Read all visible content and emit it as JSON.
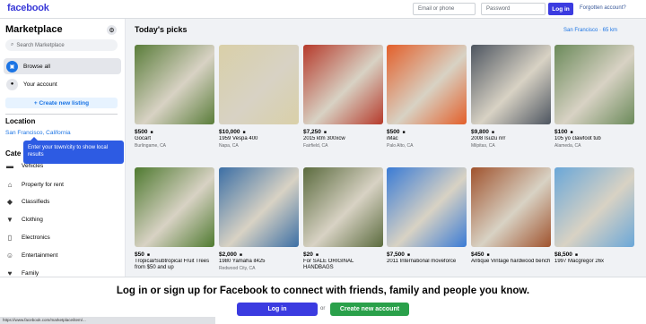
{
  "topbar": {
    "logo": "facebook",
    "email_placeholder": "Email or phone",
    "password_placeholder": "Password",
    "login_label": "Log in",
    "forgot_label": "Forgotten account?"
  },
  "sidebar": {
    "title": "Marketplace",
    "search_placeholder": "Search Marketplace",
    "items": [
      {
        "label": "Browse all",
        "icon": "shop-icon"
      },
      {
        "label": "Your account",
        "icon": "person-icon"
      }
    ],
    "create_label": "+ Create new listing",
    "location_heading": "Location",
    "location_value": "San Francisco, California",
    "categories_heading": "Cate",
    "tooltip": "Enter your town/city to show local results",
    "categories": [
      {
        "label": "Vehicles",
        "icon": "car-icon"
      },
      {
        "label": "Property for rent",
        "icon": "house-icon"
      },
      {
        "label": "Classifieds",
        "icon": "tag-icon"
      },
      {
        "label": "Clothing",
        "icon": "shirt-icon"
      },
      {
        "label": "Electronics",
        "icon": "phone-icon"
      },
      {
        "label": "Entertainment",
        "icon": "people-icon"
      },
      {
        "label": "Family",
        "icon": "heart-icon"
      }
    ]
  },
  "main": {
    "title": "Today's picks",
    "location": "San Francisco · 65 km",
    "listings": [
      {
        "price": "$500",
        "name": "Gocart",
        "place": "Burlingame, CA",
        "color": "#5a7d3a"
      },
      {
        "price": "$10,000",
        "name": "1959 Vespa 400",
        "place": "Napa, CA",
        "color": "#d9d0a8"
      },
      {
        "price": "$7,250",
        "name": "2015 ktm 300xcw",
        "place": "Fairfield, CA",
        "color": "#b63a2b"
      },
      {
        "price": "$500",
        "name": "iMac",
        "place": "Palo Alto, CA",
        "color": "#e35f2a"
      },
      {
        "price": "$9,800",
        "name": "2008 Isuzu nrr",
        "place": "Milpitas, CA",
        "color": "#4d5560"
      },
      {
        "price": "$100",
        "name": "105 yo clawfoot tub",
        "place": "Alameda, CA",
        "color": "#6b8a5a"
      },
      {
        "price": "$50",
        "name": "Tropical/Subtropical Fruit Trees from $50 and up",
        "place": "",
        "color": "#4f7a30"
      },
      {
        "price": "$2,000",
        "name": "1980 Yamaha it425",
        "place": "Redwood City, CA",
        "color": "#3c6fa5"
      },
      {
        "price": "$20",
        "name": "For SALE ORIGINAL HANDBAGS",
        "place": "",
        "color": "#5b6b3e"
      },
      {
        "price": "$7,500",
        "name": "2011 International moveforce",
        "place": "",
        "color": "#3a7bd5"
      },
      {
        "price": "$450",
        "name": "Antique Vintage hardwood bench",
        "place": "",
        "color": "#a0532e"
      },
      {
        "price": "$8,500",
        "name": "1997 Macgregor 26x",
        "place": "",
        "color": "#6aa7d8"
      }
    ]
  },
  "bottom": {
    "message": "Log in or sign up for Facebook to connect with friends, family and people you know.",
    "login_label": "Log in",
    "or_label": "or",
    "create_label": "Create new account"
  },
  "statusbar": "https://www.facebook.com/marketplace/item/..."
}
